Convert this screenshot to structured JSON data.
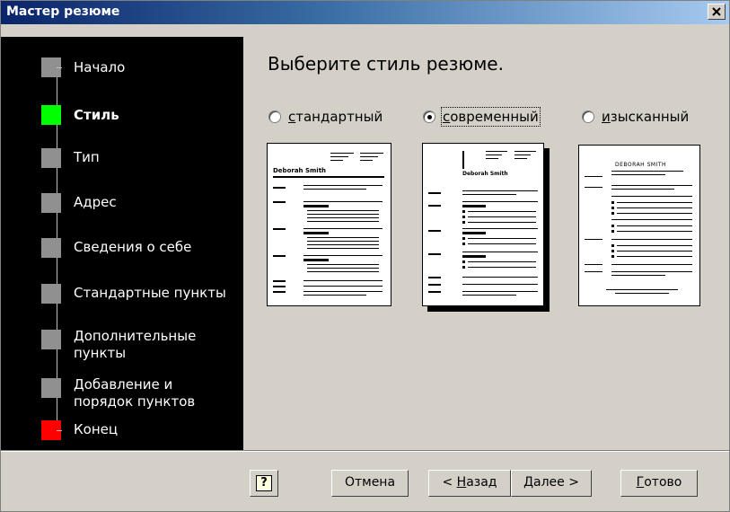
{
  "window": {
    "title": "Мастер резюме"
  },
  "steps": [
    {
      "label": "Начало",
      "color": "#909090"
    },
    {
      "label": "Стиль",
      "color": "#00ff00",
      "active": true
    },
    {
      "label": "Тип",
      "color": "#909090"
    },
    {
      "label": "Адрес",
      "color": "#909090"
    },
    {
      "label": "Сведения о себе",
      "color": "#909090"
    },
    {
      "label": "Стандартные пункты",
      "color": "#909090"
    },
    {
      "label": "Дополнительные\nпункты",
      "color": "#909090"
    },
    {
      "label": "Добавление и\nпорядок пунктов",
      "color": "#909090"
    },
    {
      "label": "Конец",
      "color": "#ff0000"
    }
  ],
  "main": {
    "heading": "Выберите стиль резюме.",
    "options": [
      {
        "key": "с",
        "rest": "тандартный",
        "selected": false
      },
      {
        "key": "с",
        "rest": "овременный",
        "selected": true
      },
      {
        "key": "и",
        "rest": "зысканный",
        "selected": false
      }
    ],
    "preview_names": [
      "Deborah Smith",
      "Deborah Smith",
      "DEBORAH SMITH"
    ]
  },
  "buttons": {
    "help_icon": "?",
    "cancel": "Отмена",
    "back_prefix": "< ",
    "back_key": "Н",
    "back_rest": "азад",
    "next_key": "Д",
    "next_rest": "алее >",
    "finish_key": "Г",
    "finish_rest": "отово"
  }
}
